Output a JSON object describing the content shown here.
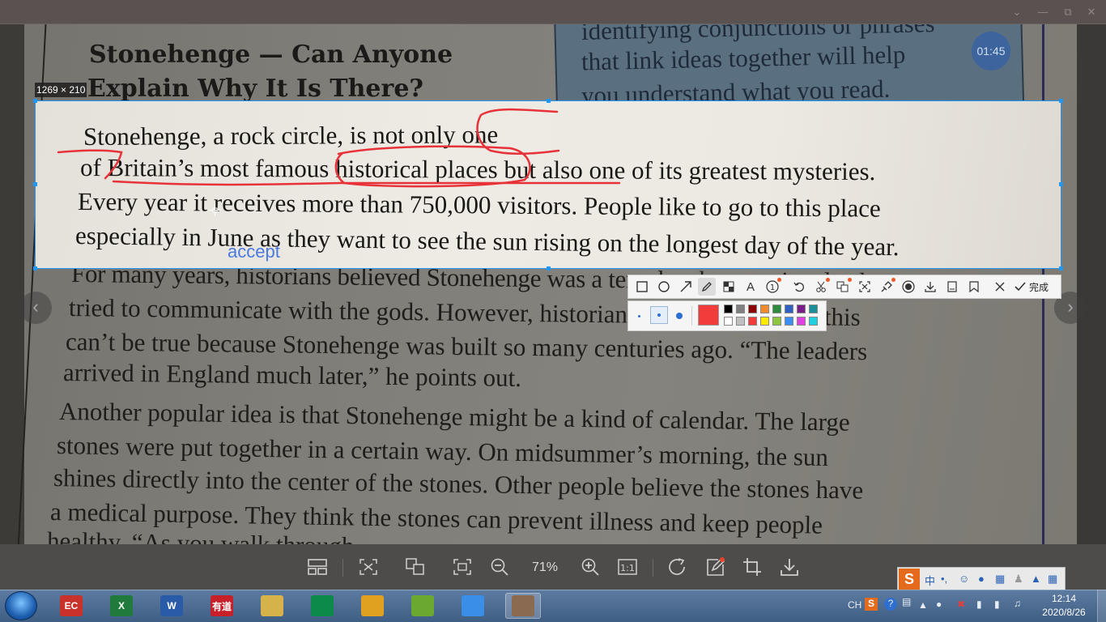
{
  "window": {
    "controls": [
      "chevron-down-icon",
      "minimize-icon",
      "restore-icon",
      "close-icon"
    ]
  },
  "photo": {
    "title_line1": "Stonehenge — Can Anyone",
    "title_line2": "Explain Why It Is There?",
    "sidebar_lines": [
      "identifying conjunctions or phrases",
      "that link ideas together will help",
      "you understand what you read."
    ],
    "body_below": [
      "For many years, historians believed Stonehenge was a temple where ancient leaders",
      "tried to communicate with the gods. However, historian Paul Stoker thinks this",
      "can’t be true because Stonehenge was built so many centuries ago. “The leaders",
      "arrived in England much later,” he points out.",
      "Another popular idea is that Stonehenge might be a kind of calendar. The large",
      "stones were put together in a certain way. On midsummer’s morning, the sun",
      "shines directly into the center of the stones. Other people believe the stones have",
      "a medical purpose. They think the stones can prevent illness and keep people",
      "healthy. “As you walk through..."
    ]
  },
  "selection": {
    "size_label": "1269 × 210",
    "lines": [
      "Stonehenge, a rock circle, is not only one",
      "of Britain’s most famous historical places but also one of its greatest mysteries.",
      "Every year it receives more than 750,000 visitors. People like to go to this place",
      "especially in June as they want to see the sun rising on the longest day of the year."
    ],
    "annotation_text": "accept"
  },
  "timer": "01:45",
  "annotation_toolbar": {
    "tools": [
      "rectangle-icon",
      "ellipse-icon",
      "arrow-icon",
      "pencil-icon",
      "mosaic-icon",
      "text-icon",
      "number-icon",
      "undo-icon",
      "cutout-icon",
      "translate-icon",
      "ocr-icon",
      "pin-icon",
      "record-icon",
      "download-icon",
      "save-icon",
      "bookmark-icon",
      "close-icon"
    ],
    "active_tool": "pencil-icon",
    "done_label": "完成",
    "brush_sizes": [
      "small",
      "medium",
      "large"
    ],
    "selected_size": "medium",
    "current_color": "#f23b3b",
    "palette_top": [
      "#000000",
      "#808080",
      "#8b0000",
      "#f28b2c",
      "#2e8b3e",
      "#2f5fc0",
      "#7a1f8a",
      "#1a8f9a"
    ],
    "palette_bottom": [
      "#ffffff",
      "#c0c0c0",
      "#f23b3b",
      "#ffea00",
      "#8ec63f",
      "#3b8ff2",
      "#e040e0",
      "#20d0e0"
    ]
  },
  "viewer_toolbar": {
    "zoom": "71%",
    "buttons": [
      "layout-icon",
      "fit-screen-icon",
      "translate-icon",
      "fullscreen-icon",
      "zoom-out-icon",
      "zoom-in-icon",
      "actual-size-icon",
      "rotate-icon",
      "edit-icon",
      "crop-icon",
      "download-icon"
    ]
  },
  "ime": {
    "logo": "S",
    "mode": "中",
    "punct": "•,"
  },
  "taskbar": {
    "apps": [
      {
        "name": "eudic",
        "label": "EC",
        "color": "#c8322a"
      },
      {
        "name": "excel",
        "label": "X",
        "color": "#1f7a3c"
      },
      {
        "name": "word",
        "label": "W",
        "color": "#2a5ba8"
      },
      {
        "name": "youdao",
        "label": "有道",
        "color": "#c8202a"
      },
      {
        "name": "file-explorer",
        "label": "",
        "color": "#d6b24a"
      },
      {
        "name": "media-app",
        "label": "",
        "color": "#0c8a4a"
      },
      {
        "name": "chrome",
        "label": "",
        "color": "#e0a020"
      },
      {
        "name": "bird-app",
        "label": "",
        "color": "#6aa830"
      },
      {
        "name": "baidu-netdisk",
        "label": "",
        "color": "#3a8ee6"
      },
      {
        "name": "photo-viewer",
        "label": "",
        "color": "#8a6a50"
      }
    ],
    "active_app": "photo-viewer",
    "tray_lang": "CH",
    "time": "12:14",
    "date": "2020/8/26"
  }
}
